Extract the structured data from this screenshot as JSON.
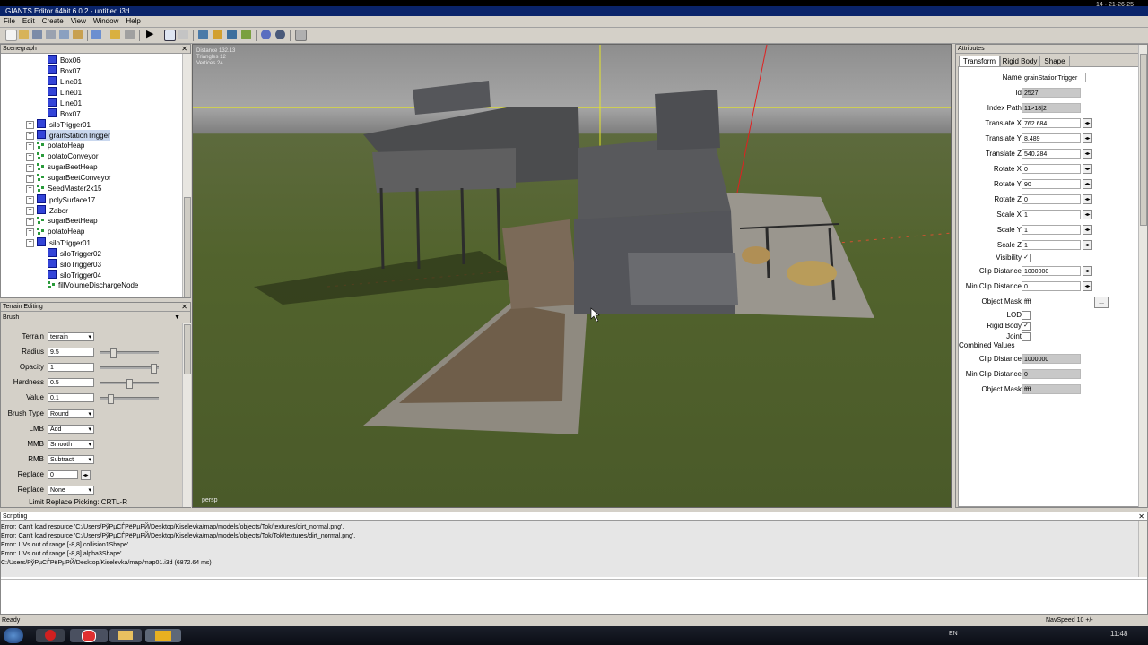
{
  "window": {
    "title": "GIANTS Editor 64bit 6.0.2 - untitled.i3d",
    "clock_top": "14 · 21·26·25"
  },
  "menu": {
    "items": [
      "File",
      "Edit",
      "Create",
      "View",
      "Window",
      "Help"
    ]
  },
  "scenegraph": {
    "title": "Scenegraph",
    "items": [
      {
        "label": "Box06",
        "icon": "cube"
      },
      {
        "label": "Box07",
        "icon": "cube"
      },
      {
        "label": "Line01",
        "icon": "cube"
      },
      {
        "label": "Line01",
        "icon": "cube"
      },
      {
        "label": "Line01",
        "icon": "cube"
      },
      {
        "label": "Box07",
        "icon": "cube"
      },
      {
        "label": "siloTrigger01",
        "icon": "cube"
      },
      {
        "label": "grainStationTrigger",
        "icon": "cube"
      },
      {
        "label": "potatoHeap",
        "icon": "nodes"
      },
      {
        "label": "potatoConveyor",
        "icon": "nodes"
      },
      {
        "label": "sugarBeetHeap",
        "icon": "nodes"
      },
      {
        "label": "sugarBeetConveyor",
        "icon": "nodes"
      },
      {
        "label": "SeedMaster2k15",
        "icon": "nodes"
      },
      {
        "label": "polySurface17",
        "icon": "cube"
      },
      {
        "label": "Zabor",
        "icon": "cube"
      },
      {
        "label": "sugarBeetHeap",
        "icon": "nodes"
      },
      {
        "label": "potatoHeap",
        "icon": "nodes"
      },
      {
        "label": "siloTrigger01",
        "icon": "cube"
      },
      {
        "label": "siloTrigger02",
        "icon": "cube"
      },
      {
        "label": "siloTrigger03",
        "icon": "cube"
      },
      {
        "label": "siloTrigger04",
        "icon": "cube"
      },
      {
        "label": "fillVolumeDischargeNode",
        "icon": "nodes"
      }
    ]
  },
  "terrain_editing": {
    "title": "Terrain Editing",
    "brush_header": "Brush",
    "terrain": {
      "label": "Terrain",
      "value": "terrain"
    },
    "radius": {
      "label": "Radius",
      "value": "9.5",
      "level": 0.2
    },
    "opacity": {
      "label": "Opacity",
      "value": "1",
      "level": 0.95
    },
    "hardness": {
      "label": "Hardness",
      "value": "0.5",
      "level": 0.5
    },
    "value": {
      "label": "Value",
      "value": "0.1",
      "level": 0.15
    },
    "brush_type": {
      "label": "Brush Type",
      "value": "Round"
    },
    "lmb": {
      "label": "LMB",
      "value": "Add"
    },
    "mmb": {
      "label": "MMB",
      "value": "Smooth"
    },
    "rmb": {
      "label": "RMB",
      "value": "Subtract"
    },
    "replace": {
      "label": "Replace",
      "value": "0"
    },
    "replace_limit": {
      "label": "Replace Limit",
      "value": "None"
    },
    "replace_picking": "Replace Picking: CRTL-R"
  },
  "viewport": {
    "stats": [
      "Distance 132.13",
      "Triangles 12",
      "Vertices 24"
    ],
    "camera": "persp"
  },
  "attributes": {
    "title": "Attributes",
    "tabs": [
      "Transform",
      "Rigid Body",
      "Shape"
    ],
    "name": {
      "label": "Name",
      "value": "grainStationTrigger"
    },
    "id": {
      "label": "Id",
      "value": "2527"
    },
    "index_path": {
      "label": "Index Path",
      "value": "11>18|2"
    },
    "translate_x": {
      "label": "Translate X",
      "value": "762.684"
    },
    "translate_y": {
      "label": "Translate Y",
      "value": "8.489"
    },
    "translate_z": {
      "label": "Translate Z",
      "value": "540.284"
    },
    "rotate_x": {
      "label": "Rotate X",
      "value": "0"
    },
    "rotate_y": {
      "label": "Rotate Y",
      "value": "90"
    },
    "rotate_z": {
      "label": "Rotate Z",
      "value": "0"
    },
    "scale_x": {
      "label": "Scale X",
      "value": "1"
    },
    "scale_y": {
      "label": "Scale Y",
      "value": "1"
    },
    "scale_z": {
      "label": "Scale Z",
      "value": "1"
    },
    "visibility": {
      "label": "Visibility",
      "checked": "✓"
    },
    "clip_distance": {
      "label": "Clip Distance",
      "value": "1000000"
    },
    "min_clip_distance": {
      "label": "Min Clip Distance",
      "value": "0"
    },
    "object_mask": {
      "label": "Object Mask",
      "value": "ffff",
      "button": "..."
    },
    "lod": {
      "label": "LOD",
      "checked": ""
    },
    "rigid_body": {
      "label": "Rigid Body",
      "checked": "✓"
    },
    "joint": {
      "label": "Joint",
      "checked": ""
    },
    "combined_header": "Combined Values",
    "c_clip_distance": {
      "label": "Clip Distance",
      "value": "1000000"
    },
    "c_min_clip_distance": {
      "label": "Min Clip Distance",
      "value": "0"
    },
    "c_object_mask": {
      "label": "Object Mask",
      "value": "ffff"
    }
  },
  "scripting": {
    "title": "Scripting",
    "lines": [
      "Error: Can't load resource 'C:/Users/РўРµСЃРёРµРЙ/Desktop/Kiselevka/map/models/objects/Tok/textures/dirt_normal.png'.",
      "Error: Can't load resource 'C:/Users/РўРµСЃРёРµРЙ/Desktop/Kiselevka/map/models/objects/Tok/Tok/textures/dirt_normal.png'.",
      "Error: UVs out of range [-8,8] collision1Shape'.",
      "Error: UVs out of range [-8,8] alpha3Shape'.",
      "C:/Users/РўРµСЃРёРµРЙ/Desktop/Kiselevka/map/map01.i3d (6872.64 ms)"
    ]
  },
  "status": {
    "left": "Ready",
    "right": "NavSpeed 10 +/-"
  },
  "taskbar": {
    "lang": "EN",
    "time": "11:48"
  }
}
